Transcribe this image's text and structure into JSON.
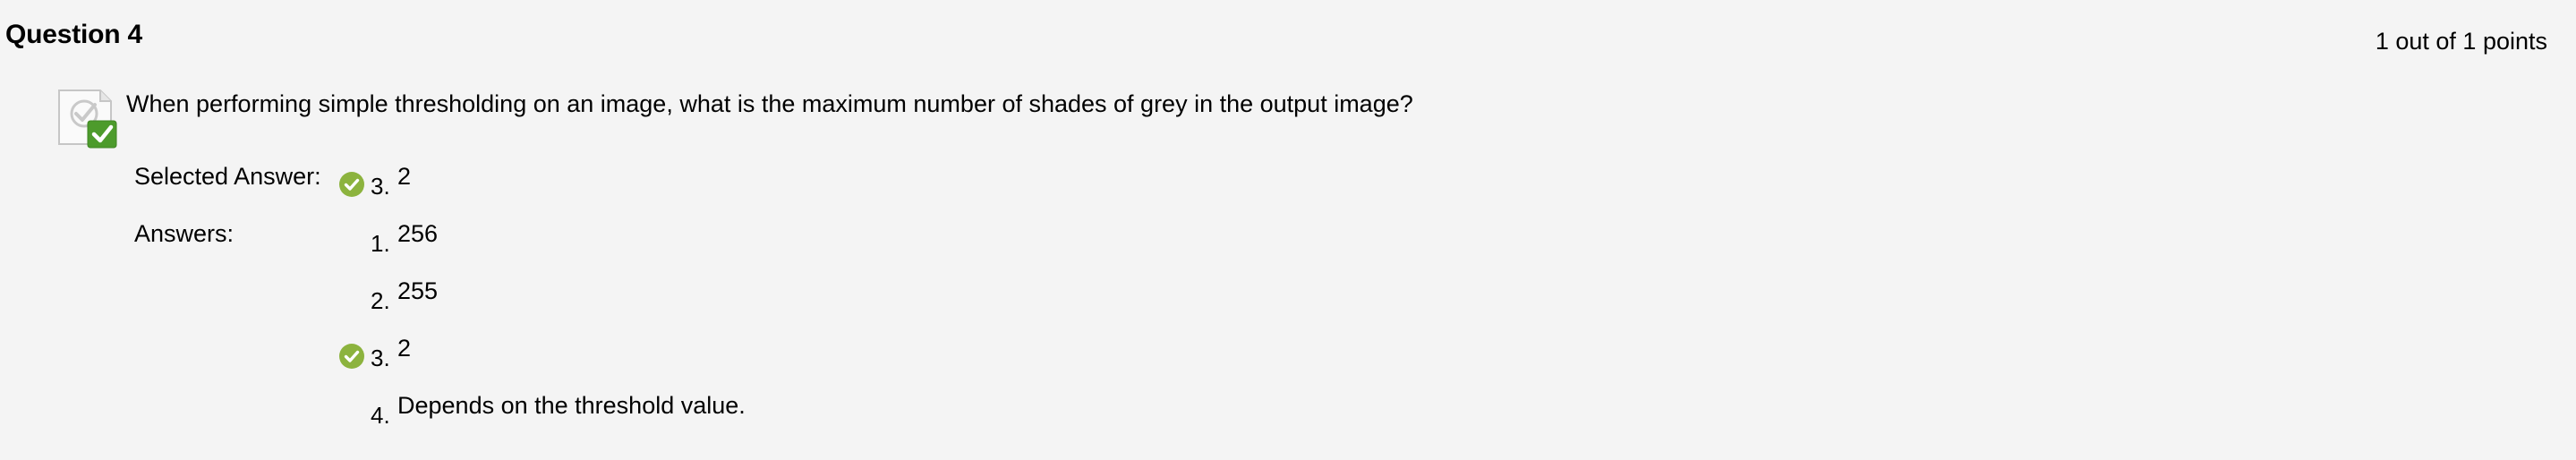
{
  "question": {
    "title": "Question 4",
    "points": "1 out of 1 points",
    "text": "When performing simple thresholding on an image, what is the maximum number of shades of grey in the output image?",
    "icon": "correct-question-icon"
  },
  "selected_answer": {
    "label": "Selected Answer:",
    "number": "3.",
    "text": "2",
    "icon": "correct-check-icon"
  },
  "answers": {
    "label": "Answers:",
    "items": [
      {
        "number": "1.",
        "text": "256",
        "correct": false
      },
      {
        "number": "2.",
        "text": "255",
        "correct": false
      },
      {
        "number": "3.",
        "text": "2",
        "correct": true,
        "icon": "correct-check-icon"
      },
      {
        "number": "4.",
        "text": "Depends on the threshold value.",
        "correct": false
      }
    ]
  },
  "colors": {
    "background": "#f4f4f4",
    "check_green": "#8cb33e",
    "badge_green": "#4d9b2c"
  }
}
